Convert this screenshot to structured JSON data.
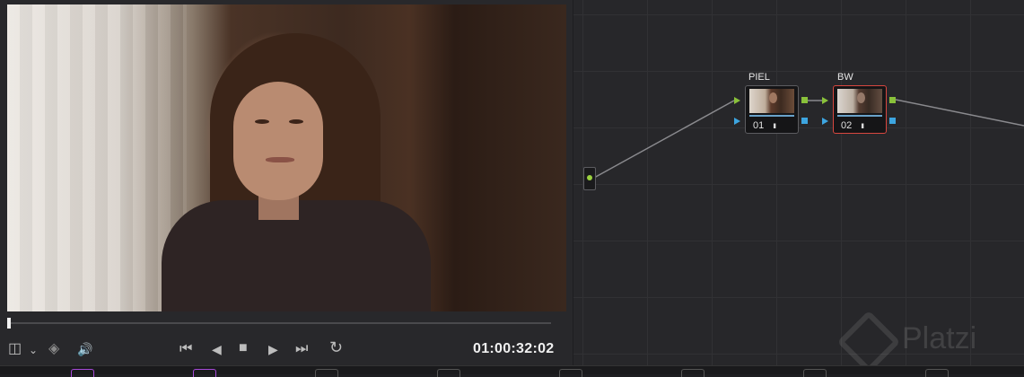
{
  "viewer": {
    "timecode": "01:00:32:02",
    "playhead_position": 0.0,
    "controls": {
      "layout_icon": "◫",
      "dropdown_icon": "⌄",
      "layers_icon": "◈",
      "volume_icon": "🔊",
      "skip_back_icon": "⏮",
      "step_back_icon": "◀",
      "stop_icon": "■",
      "play_icon": "▶",
      "skip_forward_icon": "⏭",
      "loop_icon": "↻"
    }
  },
  "node_graph": {
    "nodes": [
      {
        "label": "PIEL",
        "number": "01",
        "selected": false
      },
      {
        "label": "BW",
        "number": "02",
        "selected": true
      }
    ],
    "histogram_icon": "ııı"
  },
  "watermark": {
    "text": "Platzi"
  },
  "colors": {
    "input_green": "#89c13a",
    "input_blue": "#3da5e0",
    "selected_border": "#d8473f",
    "connection_line": "#8a8a8e"
  }
}
